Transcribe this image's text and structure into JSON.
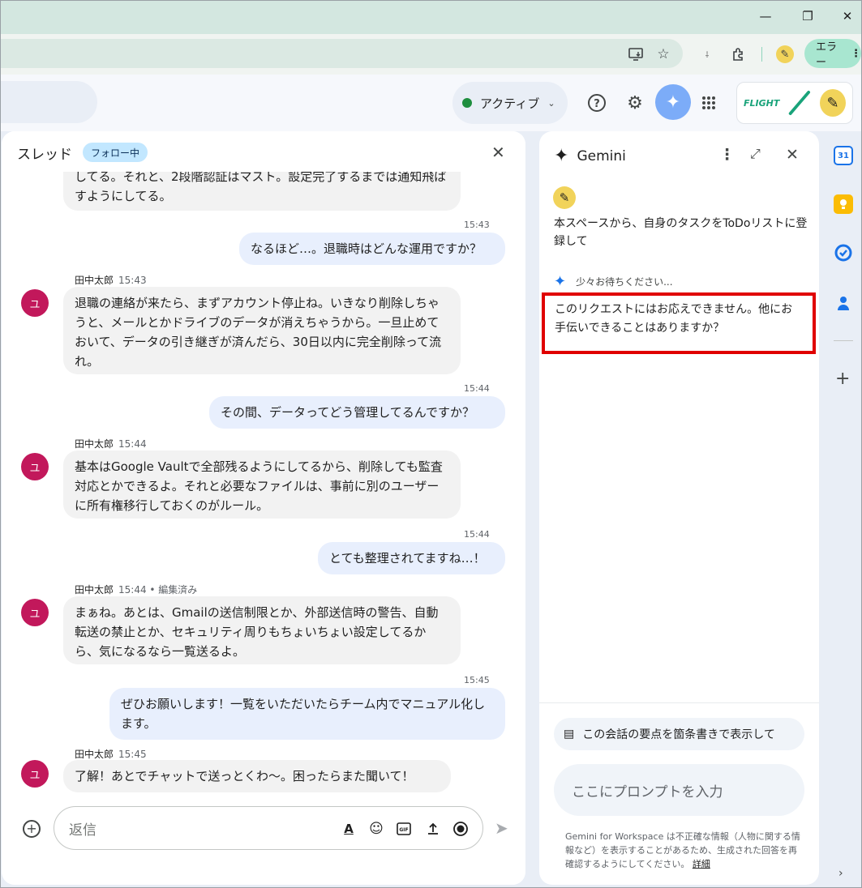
{
  "browser": {
    "error_label": "エラー",
    "menu_glyph": "⋮"
  },
  "app": {
    "status_label": "アクティブ"
  },
  "thread": {
    "title": "スレッド",
    "follow_badge": "フォロー中",
    "messages": [
      {
        "id": "m0",
        "from": "other",
        "text": "してる。それと、2段階認証はマスト。設定完了するまでは通知飛ばすようにしてる。"
      },
      {
        "id": "m1",
        "from": "me",
        "time": "15:43",
        "text": "なるほど…。退職時はどんな運用ですか？"
      },
      {
        "id": "m2",
        "from": "other",
        "sender": "田中太郎",
        "time": "15:43",
        "avatar": "ユ",
        "text": "退職の連絡が来たら、まずアカウント停止ね。いきなり削除しちゃうと、メールとかドライブのデータが消えちゃうから。一旦止めておいて、データの引き継ぎが済んだら、30日以内に完全削除って流れ。"
      },
      {
        "id": "m3",
        "from": "me",
        "time": "15:44",
        "text": "その間、データってどう管理してるんですか？"
      },
      {
        "id": "m4",
        "from": "other",
        "sender": "田中太郎",
        "time": "15:44",
        "avatar": "ユ",
        "text": "基本はGoogle Vaultで全部残るようにしてるから、削除しても監査対応とかできるよ。それと必要なファイルは、事前に別のユーザーに所有権移行しておくのがルール。"
      },
      {
        "id": "m5",
        "from": "me",
        "time": "15:44",
        "text": "とても整理されてますね…！"
      },
      {
        "id": "m6",
        "from": "other",
        "sender": "田中太郎",
        "time": "15:44 • 編集済み",
        "avatar": "ユ",
        "text": "まぁね。あとは、Gmailの送信制限とか、外部送信時の警告、自動転送の禁止とか、セキュリティ周りもちょいちょい設定してるから、気になるなら一覧送るよ。"
      },
      {
        "id": "m7",
        "from": "me",
        "time": "15:45",
        "text": "ぜひお願いします！一覧をいただいたらチーム内でマニュアル化します。"
      },
      {
        "id": "m8",
        "from": "other",
        "sender": "田中太郎",
        "time": "15:45",
        "avatar": "ユ",
        "text": "了解！あとでチャットで送っとくわ〜。困ったらまた聞いて！"
      }
    ],
    "reply_placeholder": "返信"
  },
  "gemini": {
    "title": "Gemini",
    "prompt": "本スペースから、自身のタスクをToDoリストに登録して",
    "waiting": "少々お待ちください...",
    "answer": "このリクエストにはお応えできません。他にお手伝いできることはありますか？",
    "suggestion": "この会話の要点を箇条書きで表示して",
    "input_placeholder": "ここにプロンプトを入力",
    "disclaimer": "Gemini for Workspace は不正確な情報（人物に関する情報など）を表示することがあるため、生成された回答を再確認するようにしてください。",
    "disclaimer_link": "詳細"
  },
  "org": {
    "logo_text": "FLIGHT"
  },
  "colors": {
    "accent": "#7cacf8",
    "avatar": "#c2185b",
    "highlight_border": "#e00000",
    "status_active": "#1e8e3e"
  },
  "icons": [
    "minimize-icon",
    "maximize-icon",
    "close-icon",
    "install-icon",
    "star-icon",
    "extension-icon",
    "help-icon",
    "settings-icon",
    "gemini-icon",
    "apps-grid-icon",
    "add-icon",
    "format-text-icon",
    "emoji-icon",
    "gif-icon",
    "upload-icon",
    "record-icon",
    "send-icon",
    "more-vert-icon",
    "expand-icon",
    "calendar-icon",
    "keep-icon",
    "tasks-icon",
    "contacts-icon",
    "chevron-down-icon",
    "chevron-right-icon"
  ]
}
